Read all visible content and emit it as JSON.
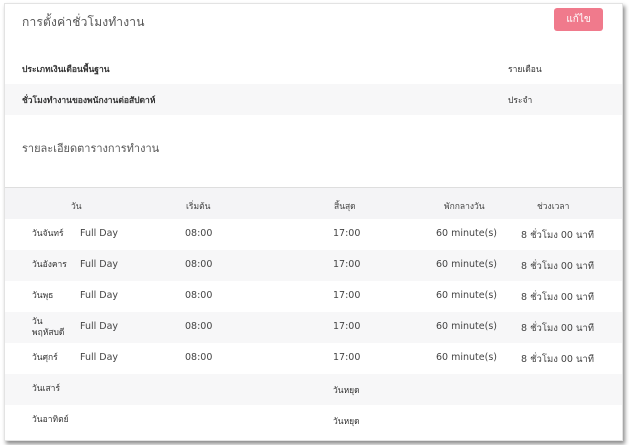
{
  "header": {
    "title": "การตั้งค่าชั่วโมงทำงาน",
    "edit_label": "แก้ไข",
    "accent_color": "#f07a8c"
  },
  "info": [
    {
      "label": "ประเภทเงินเดือนพื้นฐาน",
      "value": "รายเดือน"
    },
    {
      "label": "ชั่วโมงทำงานของพนักงานต่อสัปดาห์",
      "value": "ประจำ"
    }
  ],
  "schedule": {
    "title": "รายละเอียดตารางการทำงาน",
    "columns": [
      "วัน",
      "เริ่มต้น",
      "สิ้นสุด",
      "พักกลางวัน",
      "ช่วงเวลา"
    ],
    "rows": [
      {
        "day": "วันจันทร์",
        "type": "Full Day",
        "start": "08:00",
        "end": "17:00",
        "break": "60 minute(s)",
        "duration": "8 ชั่วโมง 00 นาที"
      },
      {
        "day": "วันอังคาร",
        "type": "Full Day",
        "start": "08:00",
        "end": "17:00",
        "break": "60 minute(s)",
        "duration": "8 ชั่วโมง 00 นาที"
      },
      {
        "day": "วันพุธ",
        "type": "Full Day",
        "start": "08:00",
        "end": "17:00",
        "break": "60 minute(s)",
        "duration": "8 ชั่วโมง 00 นาที"
      },
      {
        "day": "วัน\nพฤหัสบดี",
        "type": "Full Day",
        "start": "08:00",
        "end": "17:00",
        "break": "60 minute(s)",
        "duration": "8 ชั่วโมง 00 นาที"
      },
      {
        "day": "วันศุกร์",
        "type": "Full Day",
        "start": "08:00",
        "end": "17:00",
        "break": "60 minute(s)",
        "duration": "8 ชั่วโมง 00 นาที"
      },
      {
        "day": "วันเสาร์",
        "type": "",
        "start": "",
        "end": "วันหยุด",
        "break": "",
        "duration": ""
      },
      {
        "day": "วันอาทิตย์",
        "type": "",
        "start": "",
        "end": "วันหยุด",
        "break": "",
        "duration": ""
      }
    ]
  }
}
